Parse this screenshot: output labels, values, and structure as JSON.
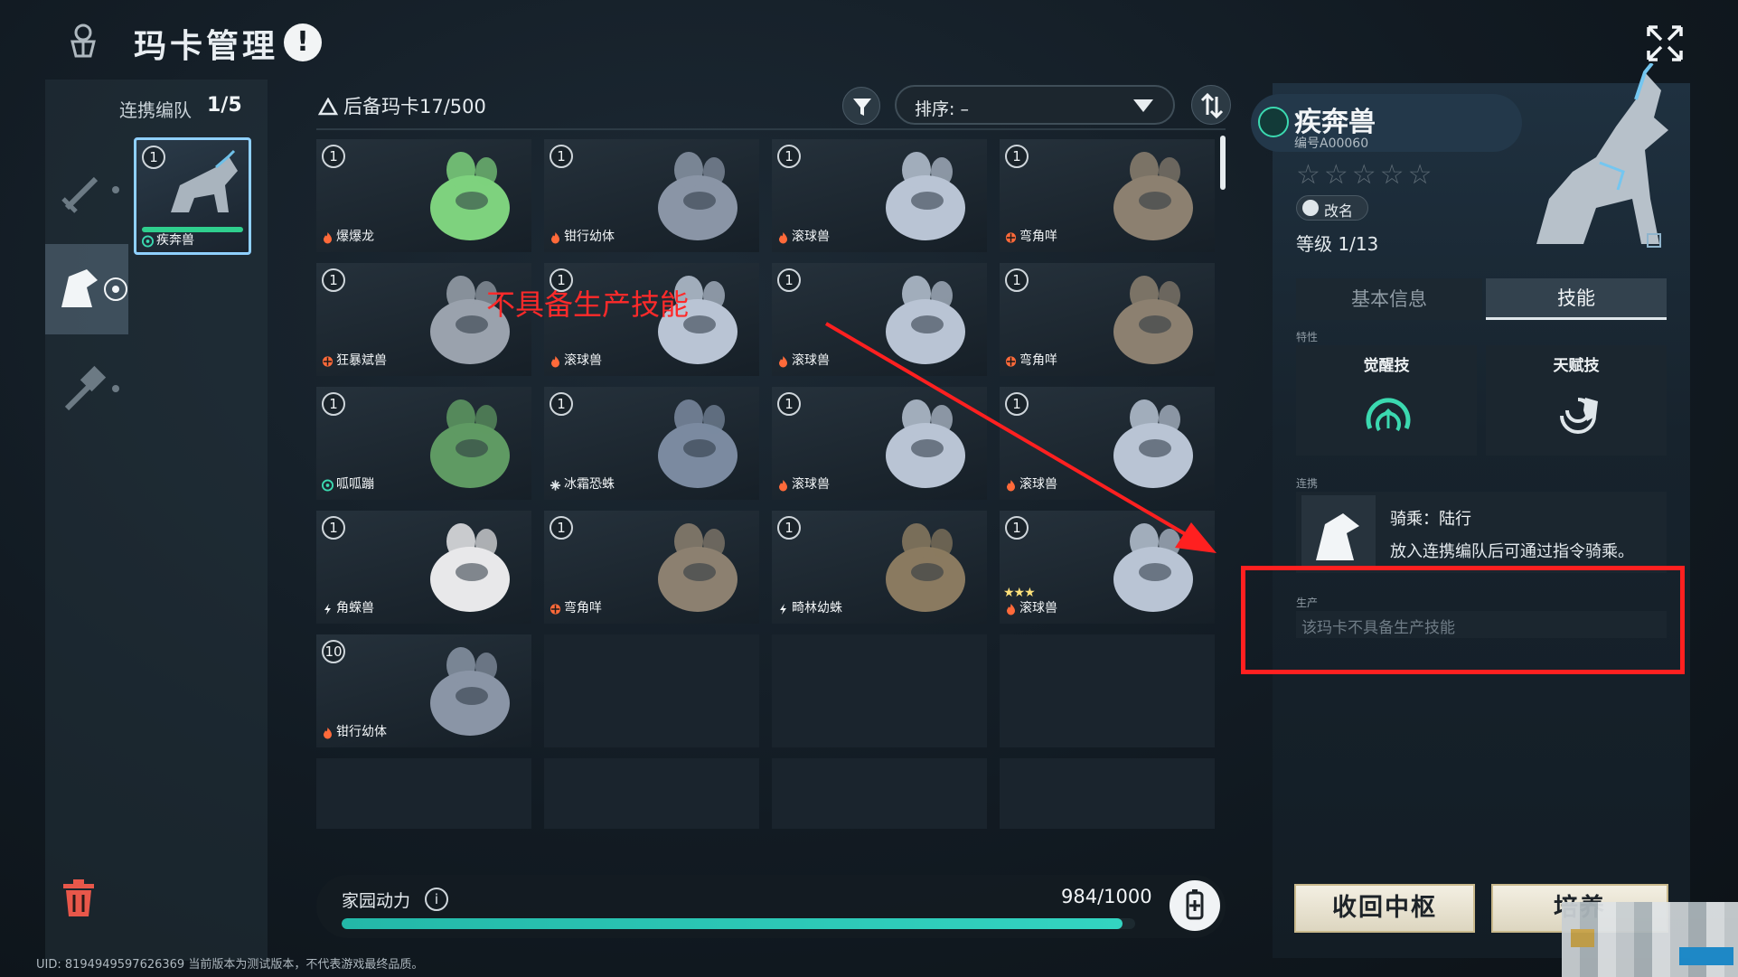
{
  "header": {
    "title": "玛卡管理",
    "alert_glyph": "!"
  },
  "team": {
    "label": "连携编队",
    "count": "1/5",
    "slot": {
      "level": "1",
      "name": "疾奔兽",
      "element": "wind"
    }
  },
  "grid": {
    "title": "后备玛卡17/500",
    "sort_label": "排序: –",
    "cards": [
      {
        "level": "1",
        "name": "爆爆龙",
        "element": "fire",
        "color": "#7ed27e"
      },
      {
        "level": "1",
        "name": "钳行幼体",
        "element": "fire",
        "color": "#8a95a6"
      },
      {
        "level": "1",
        "name": "滚球兽",
        "element": "fire",
        "color": "#b9c4d4"
      },
      {
        "level": "1",
        "name": "弯角咩",
        "element": "nature",
        "color": "#8c8070"
      },
      {
        "level": "1",
        "name": "狂暴斌兽",
        "element": "nature",
        "color": "#9aa2ad"
      },
      {
        "level": "1",
        "name": "滚球兽",
        "element": "fire",
        "color": "#b9c4d4"
      },
      {
        "level": "1",
        "name": "滚球兽",
        "element": "fire",
        "color": "#b9c4d4"
      },
      {
        "level": "1",
        "name": "弯角咩",
        "element": "nature",
        "color": "#8c8070"
      },
      {
        "level": "1",
        "name": "呱呱蹦",
        "element": "wind",
        "color": "#5f9a63"
      },
      {
        "level": "1",
        "name": "冰霜恐蛛",
        "element": "ice",
        "color": "#7b8aa0"
      },
      {
        "level": "1",
        "name": "滚球兽",
        "element": "fire",
        "color": "#b9c4d4"
      },
      {
        "level": "1",
        "name": "滚球兽",
        "element": "fire",
        "color": "#b9c4d4"
      },
      {
        "level": "1",
        "name": "角蝾兽",
        "element": "thunder",
        "color": "#e8e8ea"
      },
      {
        "level": "1",
        "name": "弯角咩",
        "element": "nature",
        "color": "#8c8070"
      },
      {
        "level": "1",
        "name": "畸林幼蛛",
        "element": "thunder",
        "color": "#8a7a60"
      },
      {
        "level": "1",
        "name": "滚球兽",
        "element": "fire",
        "color": "#b9c4d4",
        "stars": "★★★"
      },
      {
        "level": "10",
        "name": "钳行幼体",
        "element": "fire",
        "color": "#8a95a6"
      }
    ]
  },
  "annotation": {
    "text": "不具备生产技能"
  },
  "energy": {
    "label": "家园动力",
    "info_glyph": "i",
    "value": "984/1000",
    "fraction": 0.984
  },
  "uid_text": "UID: 8194949597626369 当前版本为测试版本，不代表游戏最终品质。",
  "detail": {
    "name": "疾奔兽",
    "code": "编号A00060",
    "stars": "☆☆☆☆☆",
    "rename_label": "改名",
    "level": "等级  1/13",
    "tabs": {
      "basic": "基本信息",
      "skill": "技能"
    },
    "trait_label": "特性",
    "awaken_label": "觉醒技",
    "talent_label": "天赋技",
    "link_label": "连携",
    "link_title": "骑乘：陆行",
    "link_desc": "放入连携编队后可通过指令骑乘。",
    "production_label": "生产",
    "production_text": "该玛卡不具备生产技能",
    "recall_button": "收回中枢",
    "cultivate_button": "培养"
  },
  "colors": {
    "accent_teal": "#33d4c1",
    "fire": "#ff6a3a",
    "nature": "#ff6a3a",
    "wind": "#3bd9b0",
    "ice": "#dfe6ea",
    "thunder": "#f2f5f7",
    "annotation_red": "#ff2020"
  }
}
